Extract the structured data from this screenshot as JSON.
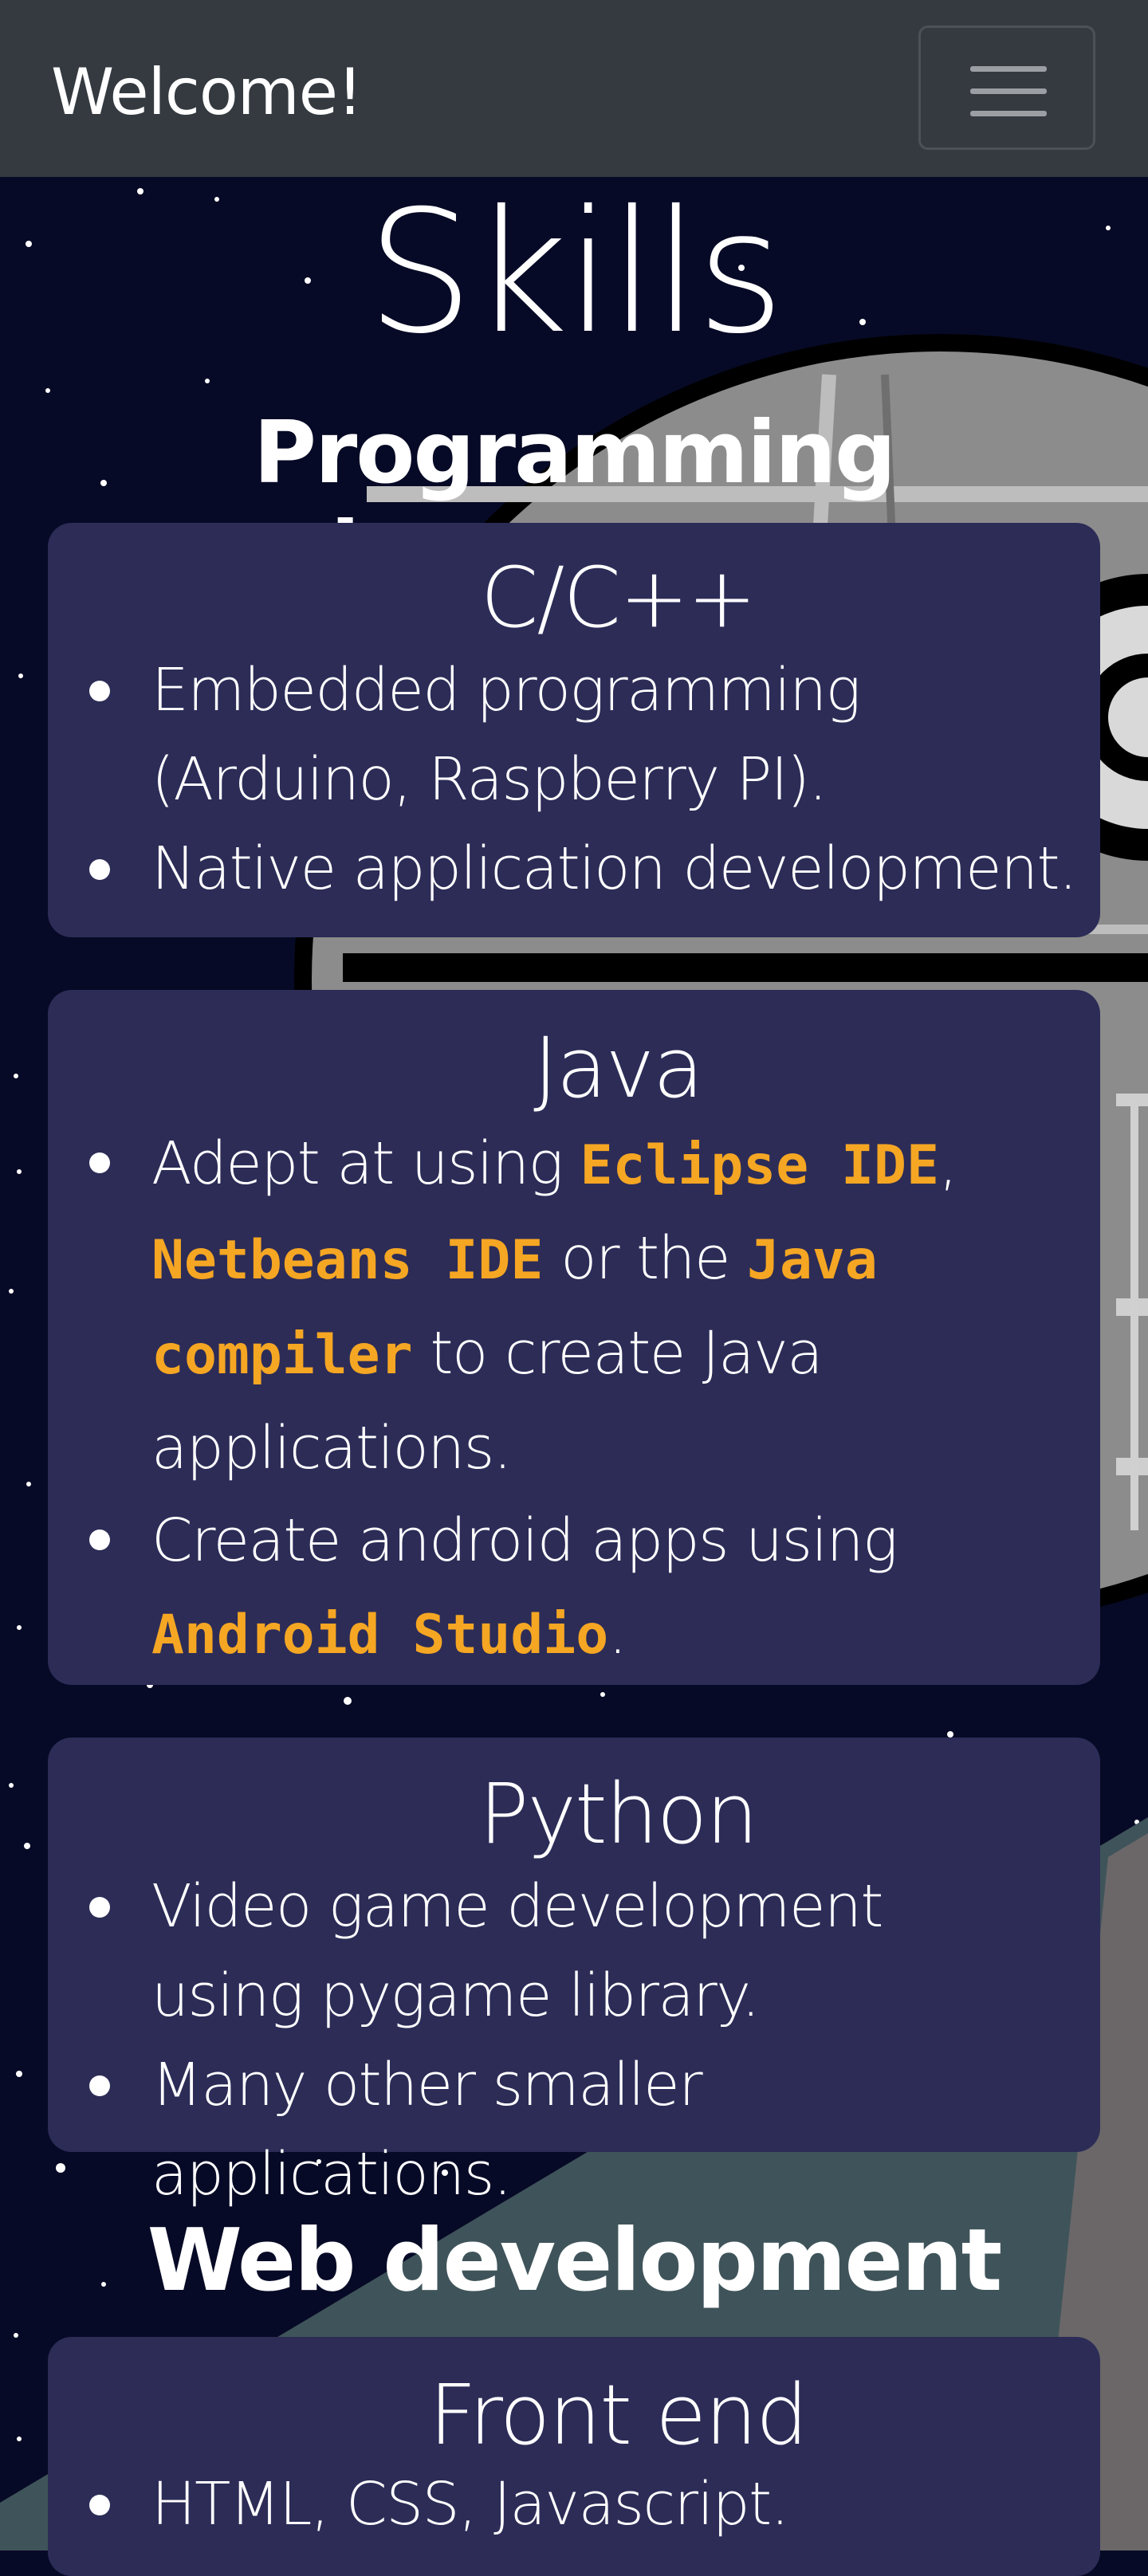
{
  "navbar": {
    "brand": "Welcome!",
    "menu_icon": "hamburger-menu-icon"
  },
  "page": {
    "title": "Skills"
  },
  "sections": {
    "programming": {
      "title": "Programming languages",
      "cards": {
        "cpp": {
          "title": "C/C++",
          "items": [
            "Embedded programming (Arduino, Raspberry PI).",
            "Native application development."
          ]
        },
        "java": {
          "title": "Java",
          "item1": {
            "t1": "Adept at using ",
            "h1": "Eclipse IDE",
            "t2": ",",
            "h2": "Netbeans IDE",
            "t3": " or the ",
            "h3": "Java",
            "h4": "compiler",
            "t4": " to create Java",
            "t5": "applications."
          },
          "item2": {
            "t1": "Create android apps using",
            "h1": "Android Studio",
            "t2": "."
          }
        },
        "python": {
          "title": "Python",
          "items": [
            "Video game development using pygame library.",
            "Many other smaller applications."
          ]
        }
      }
    },
    "web": {
      "title": "Web development",
      "cards": {
        "frontend": {
          "title": "Front end",
          "items": [
            "HTML, CSS, Javascript."
          ]
        }
      }
    }
  },
  "colors": {
    "navbar": "#343a40",
    "background": "#070a26",
    "card": "#2c2c57",
    "highlight": "#f5a623"
  }
}
